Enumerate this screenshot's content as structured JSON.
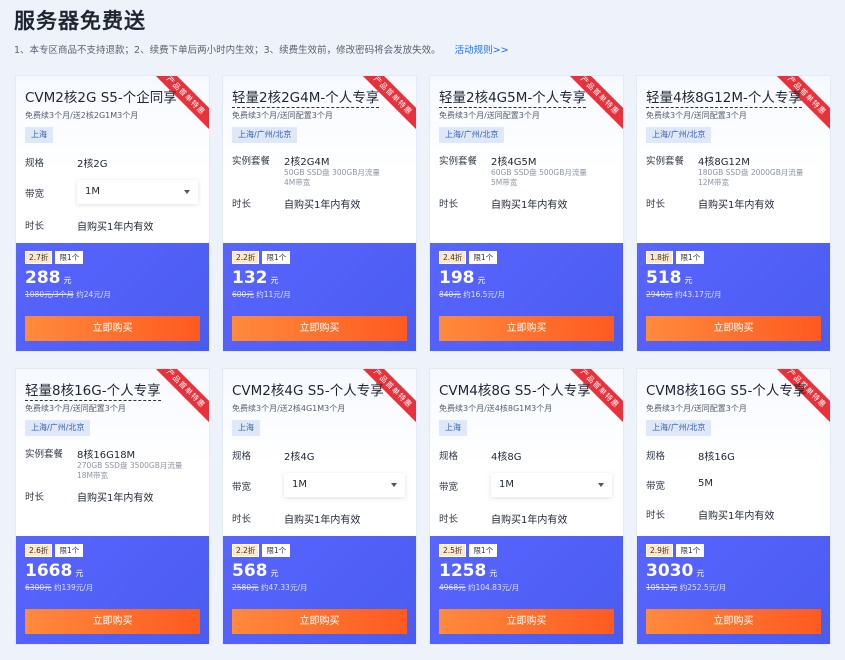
{
  "page": {
    "title": "服务器免费送",
    "rules": "1、本专区商品不支持退款；2、续费下单后两小时内生效；3、续费生效前，修改密码将会发放失效。",
    "rules_link": "活动规则>>"
  },
  "ribbon_text": "产品首单特惠",
  "cards": [
    {
      "title": "CVM2核2G S5-个企同享",
      "dashed": false,
      "subtitle": "免费续3个月/送2核2G1M3个月",
      "region": "上海",
      "spec_label": "规格",
      "spec_value": "2核2G",
      "spec_extra": [
        "",
        ""
      ],
      "bandwidth_label": "带宽",
      "bandwidth_value": "1M",
      "bandwidth_select": true,
      "duration_label": "时长",
      "duration_value": "自购买1年内有效",
      "discount": "2.7折",
      "limit": "限1个",
      "price": "288",
      "unit": "元",
      "orig_price": "1080元/3个月",
      "per_month": "约24元/月",
      "buy": "立即购买"
    },
    {
      "title": "轻量2核2G4M-个人专享",
      "dashed": true,
      "subtitle": "免费续3个月/送同配置3个月",
      "region": "上海/广州/北京",
      "spec_label": "实例套餐",
      "spec_value": "2核2G4M",
      "spec_extra": [
        "50GB SSD盘 300GB月流量",
        "4M带宽"
      ],
      "bandwidth_label": "",
      "bandwidth_value": "",
      "bandwidth_select": false,
      "duration_label": "时长",
      "duration_value": "自购买1年内有效",
      "discount": "2.2折",
      "limit": "限1个",
      "price": "132",
      "unit": "元",
      "orig_price": "600元",
      "per_month": "约11元/月",
      "buy": "立即购买"
    },
    {
      "title": "轻量2核4G5M-个人专享",
      "dashed": true,
      "subtitle": "免费续3个月/送同配置3个月",
      "region": "上海/广州/北京",
      "spec_label": "实例套餐",
      "spec_value": "2核4G5M",
      "spec_extra": [
        "60GB SSD盘 500GB月流量",
        "5M带宽"
      ],
      "bandwidth_label": "",
      "bandwidth_value": "",
      "bandwidth_select": false,
      "duration_label": "时长",
      "duration_value": "自购买1年内有效",
      "discount": "2.4折",
      "limit": "限1个",
      "price": "198",
      "unit": "元",
      "orig_price": "840元",
      "per_month": "约16.5元/月",
      "buy": "立即购买"
    },
    {
      "title": "轻量4核8G12M-个人专享",
      "dashed": true,
      "subtitle": "免费续3个月/送同配置3个月",
      "region": "上海/广州/北京",
      "spec_label": "实例套餐",
      "spec_value": "4核8G12M",
      "spec_extra": [
        "180GB SSD盘 2000GB月流量",
        "12M带宽"
      ],
      "bandwidth_label": "",
      "bandwidth_value": "",
      "bandwidth_select": false,
      "duration_label": "时长",
      "duration_value": "自购买1年内有效",
      "discount": "1.8折",
      "limit": "限1个",
      "price": "518",
      "unit": "元",
      "orig_price": "2940元",
      "per_month": "约43.17元/月",
      "buy": "立即购买"
    },
    {
      "title": "轻量8核16G-个人专享",
      "dashed": true,
      "subtitle": "免费续3个月/送同配置3个月",
      "region": "上海/广州/北京",
      "spec_label": "实例套餐",
      "spec_value": "8核16G18M",
      "spec_extra": [
        "270GB SSD盘 3500GB月流量",
        "18M带宽"
      ],
      "bandwidth_label": "",
      "bandwidth_value": "",
      "bandwidth_select": false,
      "duration_label": "时长",
      "duration_value": "自购买1年内有效",
      "discount": "2.6折",
      "limit": "限1个",
      "price": "1668",
      "unit": "元",
      "orig_price": "6300元",
      "per_month": "约139元/月",
      "buy": "立即购买"
    },
    {
      "title": "CVM2核4G S5-个人专享",
      "dashed": false,
      "subtitle": "免费续3个月/送2核4G1M3个月",
      "region": "上海",
      "spec_label": "规格",
      "spec_value": "2核4G",
      "spec_extra": [
        "",
        ""
      ],
      "bandwidth_label": "带宽",
      "bandwidth_value": "1M",
      "bandwidth_select": true,
      "duration_label": "时长",
      "duration_value": "自购买1年内有效",
      "discount": "2.2折",
      "limit": "限1个",
      "price": "568",
      "unit": "元",
      "orig_price": "2580元",
      "per_month": "约47.33元/月",
      "buy": "立即购买"
    },
    {
      "title": "CVM4核8G S5-个人专享",
      "dashed": false,
      "subtitle": "免费续3个月/送4核8G1M3个月",
      "region": "上海",
      "spec_label": "规格",
      "spec_value": "4核8G",
      "spec_extra": [
        "",
        ""
      ],
      "bandwidth_label": "带宽",
      "bandwidth_value": "1M",
      "bandwidth_select": true,
      "duration_label": "时长",
      "duration_value": "自购买1年内有效",
      "discount": "2.5折",
      "limit": "限1个",
      "price": "1258",
      "unit": "元",
      "orig_price": "4968元",
      "per_month": "约104.83元/月",
      "buy": "立即购买"
    },
    {
      "title": "CVM8核16G S5-个人专享",
      "dashed": false,
      "subtitle": "免费续3个月/送同配置3个月",
      "region": "上海/广州/北京",
      "spec_label": "规格",
      "spec_value": "8核16G",
      "spec_extra": [
        "",
        ""
      ],
      "bandwidth_label": "带宽",
      "bandwidth_value": "5M",
      "bandwidth_select": false,
      "duration_label": "时长",
      "duration_value": "自购买1年内有效",
      "discount": "2.9折",
      "limit": "限1个",
      "price": "3030",
      "unit": "元",
      "orig_price": "10512元",
      "per_month": "约252.5元/月",
      "buy": "立即购买"
    }
  ]
}
